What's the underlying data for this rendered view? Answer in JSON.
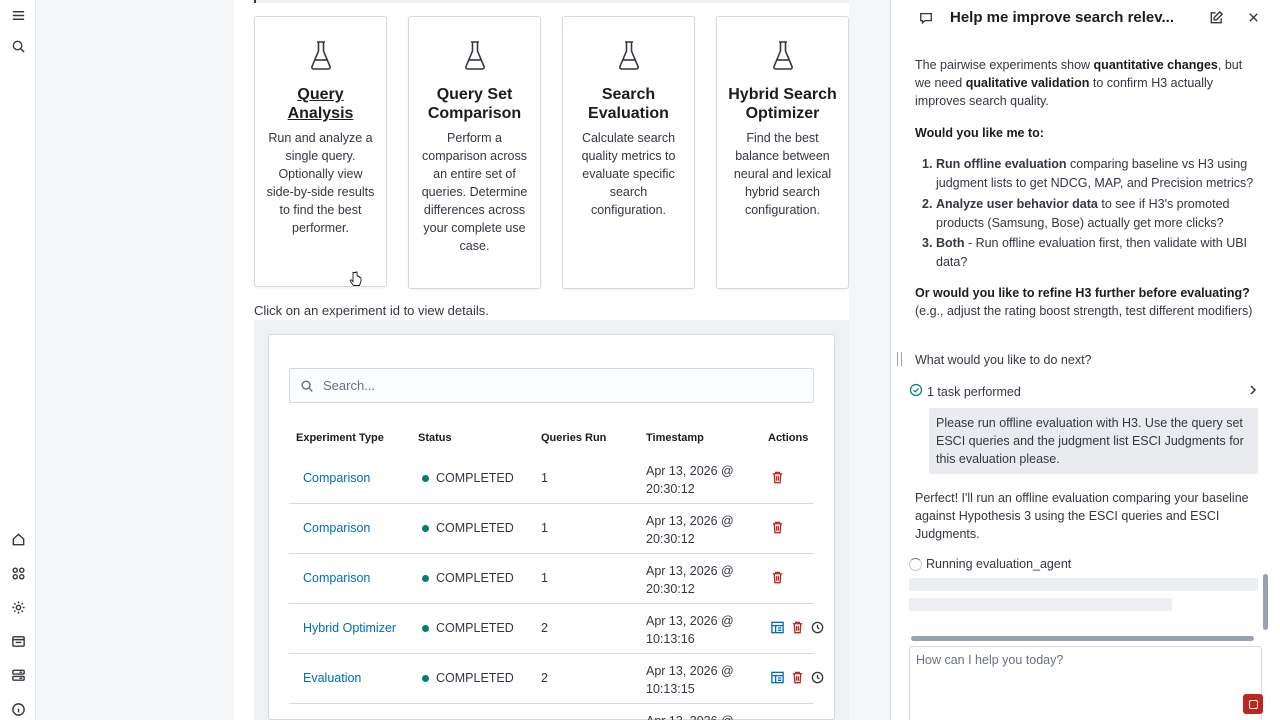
{
  "nav": {
    "icons": [
      "menu-icon",
      "search-icon",
      "home-icon",
      "apps-icon",
      "gear-icon",
      "console-icon",
      "storage-icon",
      "info-icon"
    ]
  },
  "cards": [
    {
      "title": "Query Analysis",
      "desc": "Run and analyze a single query. Optionally view side-by-side results to find the best performer.",
      "link": true
    },
    {
      "title": "Query Set Comparison",
      "desc": "Perform a comparison across an entire set of queries. Determine differences across your complete use case.",
      "link": false
    },
    {
      "title": "Search Evaluation",
      "desc": "Calculate search quality metrics to evaluate specific search configuration.",
      "link": false
    },
    {
      "title": "Hybrid Search Optimizer",
      "desc": "Find the best balance between neural and lexical hybrid search configuration.",
      "link": false
    }
  ],
  "hint": "Click on an experiment id to view details.",
  "search": {
    "placeholder": "Search..."
  },
  "table": {
    "headers": {
      "type": "Experiment Type",
      "status": "Status",
      "runs": "Queries Run",
      "timestamp": "Timestamp",
      "actions": "Actions"
    },
    "rows": [
      {
        "type": "Comparison",
        "status": "COMPLETED",
        "runs": "1",
        "timestamp": "Apr 13, 2026 @ 20:30:12",
        "extra": false
      },
      {
        "type": "Comparison",
        "status": "COMPLETED",
        "runs": "1",
        "timestamp": "Apr 13, 2026 @ 20:30:12",
        "extra": false
      },
      {
        "type": "Comparison",
        "status": "COMPLETED",
        "runs": "1",
        "timestamp": "Apr 13, 2026 @ 20:30:12",
        "extra": false
      },
      {
        "type": "Hybrid Optimizer",
        "status": "COMPLETED",
        "runs": "2",
        "timestamp": "Apr 13, 2026 @ 10:13:16",
        "extra": true
      },
      {
        "type": "Evaluation",
        "status": "COMPLETED",
        "runs": "2",
        "timestamp": "Apr 13, 2026 @ 10:13:15",
        "extra": true
      },
      {
        "type": "",
        "status": "",
        "runs": "",
        "timestamp": "Apr 13, 2026 @",
        "extra": false
      }
    ]
  },
  "chat": {
    "title": "Help me improve search relev...",
    "intro_a": "The pairwise experiments show ",
    "intro_b": "quantitative changes",
    "intro_c": ", but we need ",
    "intro_d": "qualitative validation",
    "intro_e": " to confirm H3 actually improves search quality.",
    "ask": "Would you like me to:",
    "options": [
      {
        "num": "1.",
        "bold": "Run offline evaluation",
        "text": " comparing baseline vs H3 using judgment lists to get NDCG, MAP, and Precision metrics?"
      },
      {
        "num": "2.",
        "bold": "Analyze user behavior data",
        "text": " to see if H3's promoted products (Samsung, Bose) actually get more clicks?"
      },
      {
        "num": "3.",
        "bold": "Both",
        "text": " - Run offline evaluation first, then validate with UBI data?"
      }
    ],
    "refine_bold": "Or would you like to refine H3 further before evaluating?",
    "refine_text": " (e.g., adjust the rating boost strength, test different modifiers)",
    "next": "What would you like to do next?",
    "task": "1 task performed",
    "user_msg": "Please run offline evaluation with H3. Use the query set ESCI queries and the judgment list ESCI Judgments for this evaluation please.",
    "reply": "Perfect! I'll run an offline evaluation comparing your baseline against Hypothesis 3 using the ESCI queries and ESCI Judgments.",
    "running": "Running evaluation_agent",
    "composer_placeholder": "How can I help you today?"
  }
}
